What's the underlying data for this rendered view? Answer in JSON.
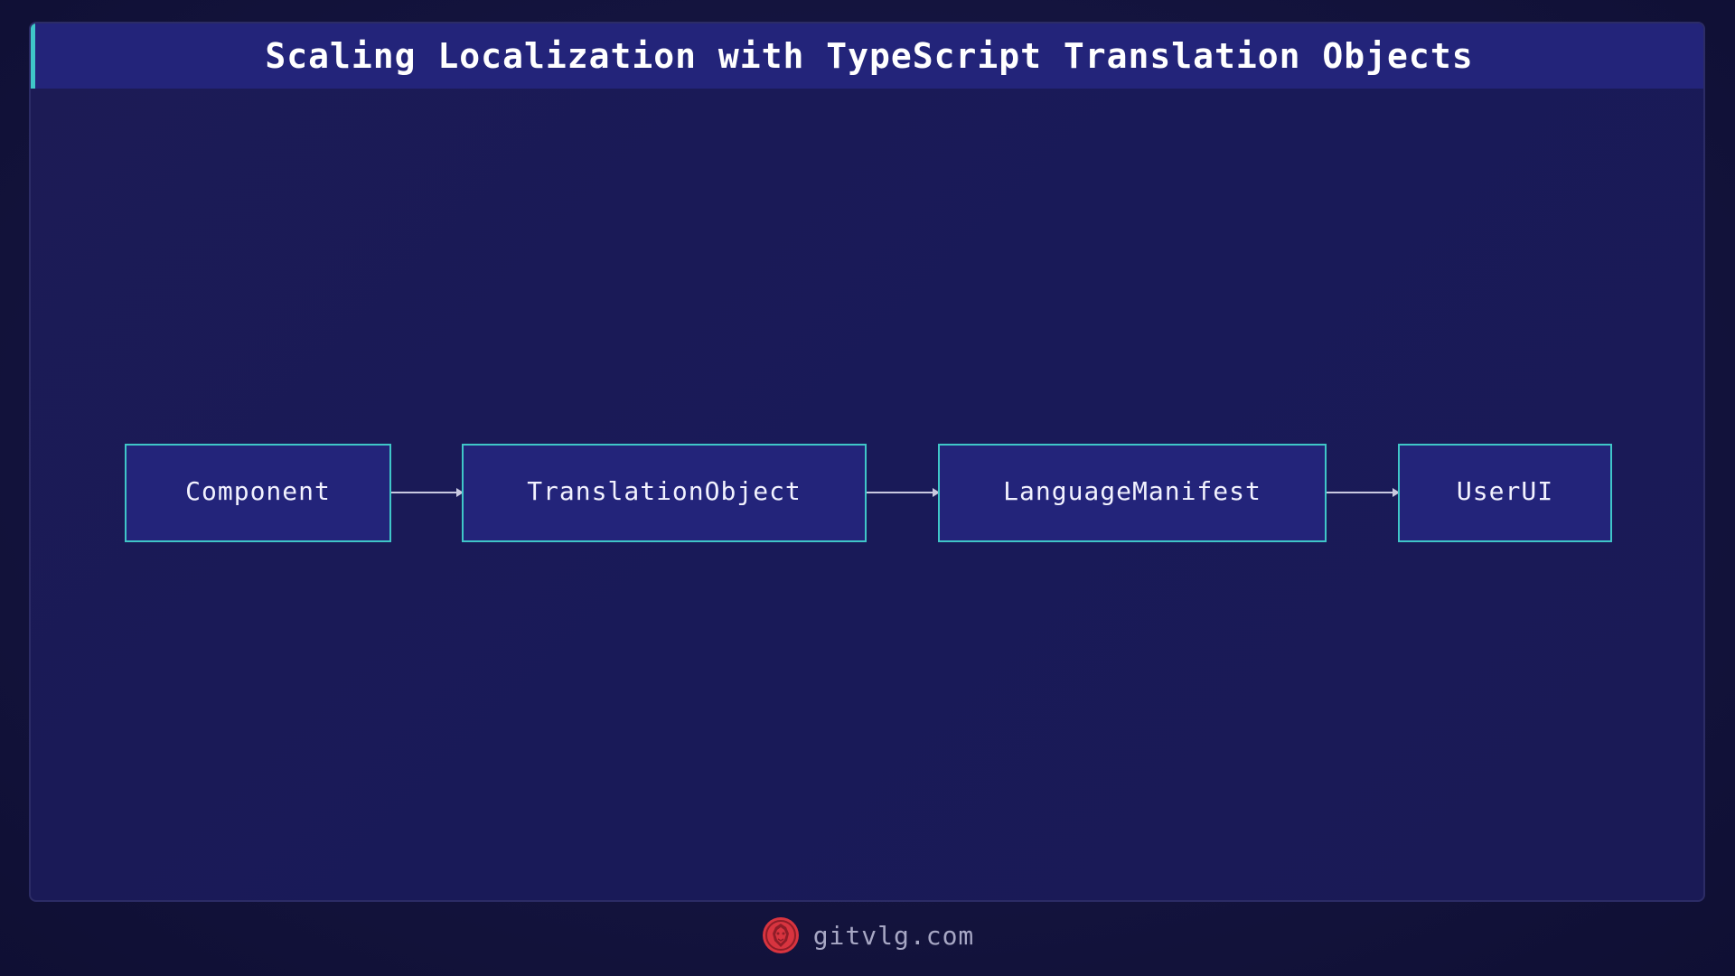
{
  "header": {
    "title": "Scaling Localization with TypeScript Translation Objects"
  },
  "diagram": {
    "nodes": [
      {
        "label": "Component"
      },
      {
        "label": "TranslationObject"
      },
      {
        "label": "LanguageManifest"
      },
      {
        "label": "UserUI"
      }
    ],
    "edges": [
      {
        "from": "Component",
        "to": "TranslationObject"
      },
      {
        "from": "TranslationObject",
        "to": "LanguageManifest"
      },
      {
        "from": "LanguageManifest",
        "to": "UserUI"
      }
    ]
  },
  "footer": {
    "site": "gitvlg.com",
    "logo_icon": "lion-head-icon"
  },
  "colors": {
    "background": "#14143f",
    "title_bar": "#23247a",
    "accent": "#3fc6c8",
    "node_fill": "#23247a",
    "arrow": "#c9c9e0",
    "logo": "#d8343f"
  }
}
